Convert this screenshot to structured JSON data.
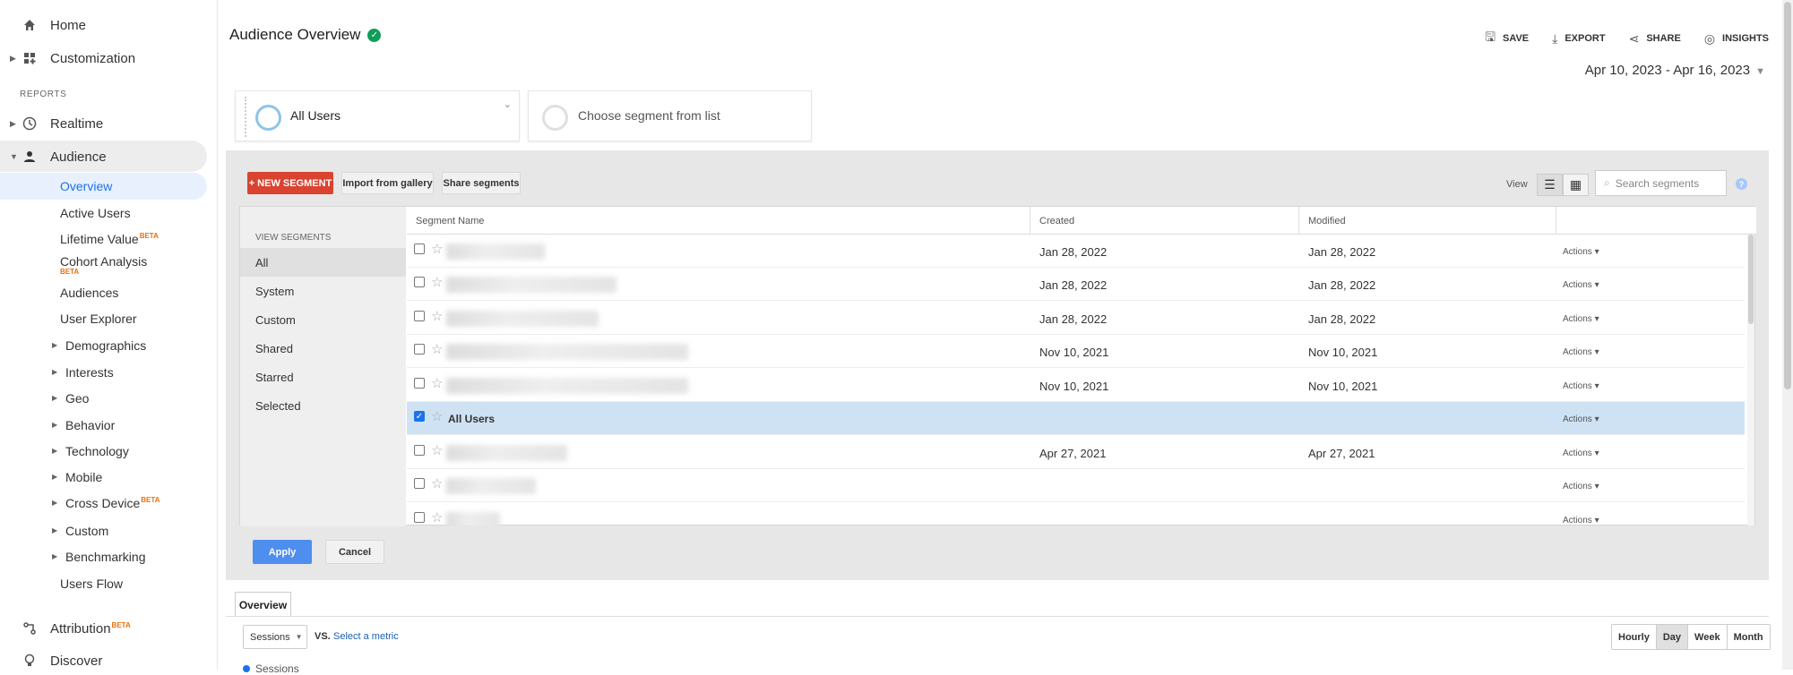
{
  "sidebar": {
    "home": "Home",
    "customization": "Customization",
    "reports_label": "REPORTS",
    "realtime": "Realtime",
    "audience": "Audience",
    "sub_items": [
      "Overview",
      "Active Users",
      "Lifetime Value",
      "Cohort Analysis",
      "Audiences",
      "User Explorer",
      "Demographics",
      "Interests",
      "Geo",
      "Behavior",
      "Technology",
      "Mobile",
      "Cross Device",
      "Custom",
      "Benchmarking",
      "Users Flow"
    ],
    "beta": "BETA",
    "attribution": "Attribution",
    "discover": "Discover"
  },
  "header": {
    "title": "Audience Overview",
    "actions": {
      "save": "SAVE",
      "export": "EXPORT",
      "share": "SHARE",
      "insights": "INSIGHTS"
    },
    "date_range": "Apr 10, 2023 - Apr 16, 2023"
  },
  "segments": {
    "active": "All Users",
    "choose": "Choose segment from list"
  },
  "segment_panel": {
    "new_segment": "+ NEW SEGMENT",
    "import": "Import from gallery",
    "share": "Share segments",
    "view_label": "View",
    "search_placeholder": "Search segments",
    "help": "?",
    "filter_head": "VIEW SEGMENTS",
    "filters": [
      "All",
      "System",
      "Custom",
      "Shared",
      "Starred",
      "Selected"
    ],
    "columns": {
      "name": "Segment Name",
      "created": "Created",
      "modified": "Modified"
    },
    "rows": [
      {
        "name": "",
        "created": "Jan 28, 2022",
        "modified": "Jan 28, 2022",
        "actions": "Actions ▾",
        "checked": false
      },
      {
        "name": "",
        "created": "Jan 28, 2022",
        "modified": "Jan 28, 2022",
        "actions": "Actions ▾",
        "checked": false
      },
      {
        "name": "",
        "created": "Jan 28, 2022",
        "modified": "Jan 28, 2022",
        "actions": "Actions ▾",
        "checked": false
      },
      {
        "name": "",
        "created": "Nov 10, 2021",
        "modified": "Nov 10, 2021",
        "actions": "Actions ▾",
        "checked": false
      },
      {
        "name": "",
        "created": "Nov 10, 2021",
        "modified": "Nov 10, 2021",
        "actions": "Actions ▾",
        "checked": false
      },
      {
        "name": "All Users",
        "created": "",
        "modified": "",
        "actions": "Actions ▾",
        "checked": true
      },
      {
        "name": "",
        "created": "Apr 27, 2021",
        "modified": "Apr 27, 2021",
        "actions": "Actions ▾",
        "checked": false
      },
      {
        "name": "",
        "created": "",
        "modified": "",
        "actions": "Actions ▾",
        "checked": false
      },
      {
        "name": "",
        "created": "",
        "modified": "",
        "actions": "Actions ▾",
        "checked": false
      }
    ],
    "apply": "Apply",
    "cancel": "Cancel"
  },
  "overview": {
    "tab": "Overview",
    "metric": "Sessions",
    "vs": "VS.",
    "select_metric": "Select a metric",
    "granularity": [
      "Hourly",
      "Day",
      "Week",
      "Month"
    ],
    "series": "Sessions"
  }
}
